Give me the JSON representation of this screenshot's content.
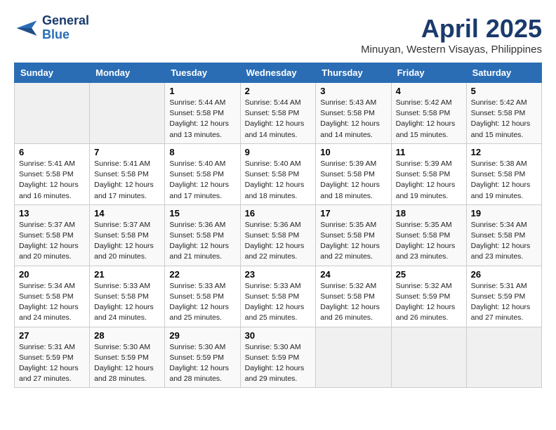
{
  "header": {
    "logo_line1": "General",
    "logo_line2": "Blue",
    "title": "April 2025",
    "subtitle": "Minuyan, Western Visayas, Philippines"
  },
  "days_of_week": [
    "Sunday",
    "Monday",
    "Tuesday",
    "Wednesday",
    "Thursday",
    "Friday",
    "Saturday"
  ],
  "weeks": [
    [
      {
        "day": "",
        "info": ""
      },
      {
        "day": "",
        "info": ""
      },
      {
        "day": "1",
        "info": "Sunrise: 5:44 AM\nSunset: 5:58 PM\nDaylight: 12 hours\nand 13 minutes."
      },
      {
        "day": "2",
        "info": "Sunrise: 5:44 AM\nSunset: 5:58 PM\nDaylight: 12 hours\nand 14 minutes."
      },
      {
        "day": "3",
        "info": "Sunrise: 5:43 AM\nSunset: 5:58 PM\nDaylight: 12 hours\nand 14 minutes."
      },
      {
        "day": "4",
        "info": "Sunrise: 5:42 AM\nSunset: 5:58 PM\nDaylight: 12 hours\nand 15 minutes."
      },
      {
        "day": "5",
        "info": "Sunrise: 5:42 AM\nSunset: 5:58 PM\nDaylight: 12 hours\nand 15 minutes."
      }
    ],
    [
      {
        "day": "6",
        "info": "Sunrise: 5:41 AM\nSunset: 5:58 PM\nDaylight: 12 hours\nand 16 minutes."
      },
      {
        "day": "7",
        "info": "Sunrise: 5:41 AM\nSunset: 5:58 PM\nDaylight: 12 hours\nand 17 minutes."
      },
      {
        "day": "8",
        "info": "Sunrise: 5:40 AM\nSunset: 5:58 PM\nDaylight: 12 hours\nand 17 minutes."
      },
      {
        "day": "9",
        "info": "Sunrise: 5:40 AM\nSunset: 5:58 PM\nDaylight: 12 hours\nand 18 minutes."
      },
      {
        "day": "10",
        "info": "Sunrise: 5:39 AM\nSunset: 5:58 PM\nDaylight: 12 hours\nand 18 minutes."
      },
      {
        "day": "11",
        "info": "Sunrise: 5:39 AM\nSunset: 5:58 PM\nDaylight: 12 hours\nand 19 minutes."
      },
      {
        "day": "12",
        "info": "Sunrise: 5:38 AM\nSunset: 5:58 PM\nDaylight: 12 hours\nand 19 minutes."
      }
    ],
    [
      {
        "day": "13",
        "info": "Sunrise: 5:37 AM\nSunset: 5:58 PM\nDaylight: 12 hours\nand 20 minutes."
      },
      {
        "day": "14",
        "info": "Sunrise: 5:37 AM\nSunset: 5:58 PM\nDaylight: 12 hours\nand 20 minutes."
      },
      {
        "day": "15",
        "info": "Sunrise: 5:36 AM\nSunset: 5:58 PM\nDaylight: 12 hours\nand 21 minutes."
      },
      {
        "day": "16",
        "info": "Sunrise: 5:36 AM\nSunset: 5:58 PM\nDaylight: 12 hours\nand 22 minutes."
      },
      {
        "day": "17",
        "info": "Sunrise: 5:35 AM\nSunset: 5:58 PM\nDaylight: 12 hours\nand 22 minutes."
      },
      {
        "day": "18",
        "info": "Sunrise: 5:35 AM\nSunset: 5:58 PM\nDaylight: 12 hours\nand 23 minutes."
      },
      {
        "day": "19",
        "info": "Sunrise: 5:34 AM\nSunset: 5:58 PM\nDaylight: 12 hours\nand 23 minutes."
      }
    ],
    [
      {
        "day": "20",
        "info": "Sunrise: 5:34 AM\nSunset: 5:58 PM\nDaylight: 12 hours\nand 24 minutes."
      },
      {
        "day": "21",
        "info": "Sunrise: 5:33 AM\nSunset: 5:58 PM\nDaylight: 12 hours\nand 24 minutes."
      },
      {
        "day": "22",
        "info": "Sunrise: 5:33 AM\nSunset: 5:58 PM\nDaylight: 12 hours\nand 25 minutes."
      },
      {
        "day": "23",
        "info": "Sunrise: 5:33 AM\nSunset: 5:58 PM\nDaylight: 12 hours\nand 25 minutes."
      },
      {
        "day": "24",
        "info": "Sunrise: 5:32 AM\nSunset: 5:58 PM\nDaylight: 12 hours\nand 26 minutes."
      },
      {
        "day": "25",
        "info": "Sunrise: 5:32 AM\nSunset: 5:59 PM\nDaylight: 12 hours\nand 26 minutes."
      },
      {
        "day": "26",
        "info": "Sunrise: 5:31 AM\nSunset: 5:59 PM\nDaylight: 12 hours\nand 27 minutes."
      }
    ],
    [
      {
        "day": "27",
        "info": "Sunrise: 5:31 AM\nSunset: 5:59 PM\nDaylight: 12 hours\nand 27 minutes."
      },
      {
        "day": "28",
        "info": "Sunrise: 5:30 AM\nSunset: 5:59 PM\nDaylight: 12 hours\nand 28 minutes."
      },
      {
        "day": "29",
        "info": "Sunrise: 5:30 AM\nSunset: 5:59 PM\nDaylight: 12 hours\nand 28 minutes."
      },
      {
        "day": "30",
        "info": "Sunrise: 5:30 AM\nSunset: 5:59 PM\nDaylight: 12 hours\nand 29 minutes."
      },
      {
        "day": "",
        "info": ""
      },
      {
        "day": "",
        "info": ""
      },
      {
        "day": "",
        "info": ""
      }
    ]
  ]
}
